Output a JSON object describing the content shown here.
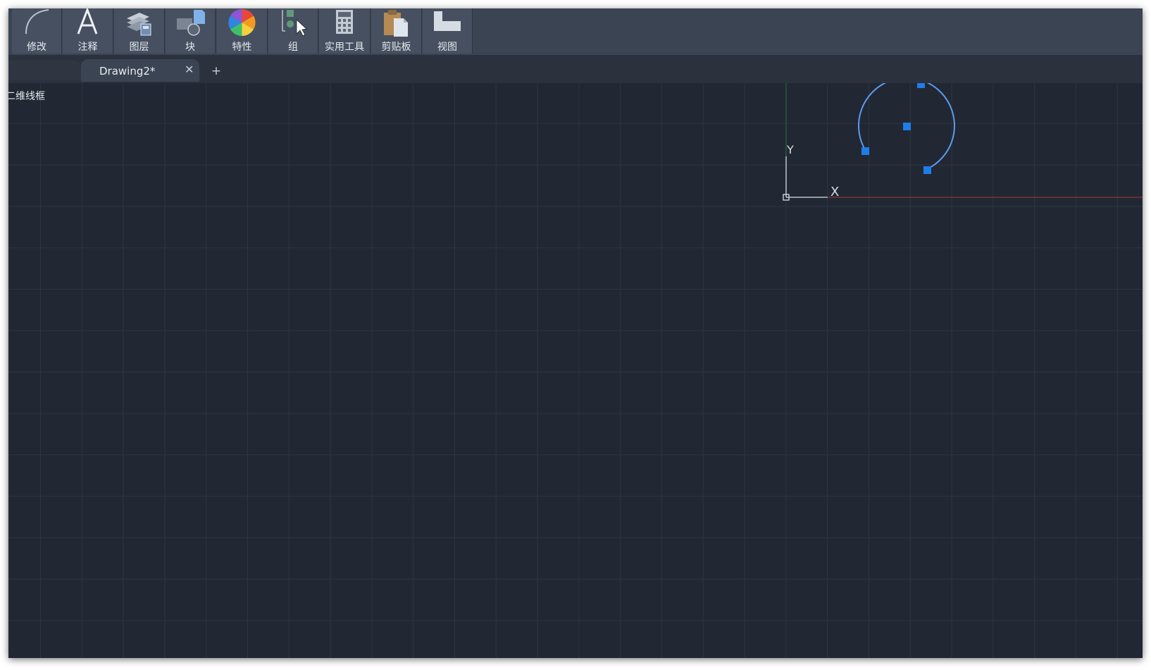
{
  "ribbon": {
    "groups": [
      {
        "id": "modify",
        "label": "修改",
        "icon": "arc-icon"
      },
      {
        "id": "annotation",
        "label": "注释",
        "icon": "text-a-icon"
      },
      {
        "id": "layers",
        "label": "图层",
        "icon": "layers-icon"
      },
      {
        "id": "block",
        "label": "块",
        "icon": "block-icon"
      },
      {
        "id": "properties",
        "label": "特性",
        "icon": "color-wheel-icon"
      },
      {
        "id": "group",
        "label": "组",
        "icon": "group-select-icon"
      },
      {
        "id": "utilities",
        "label": "实用工具",
        "icon": "calculator-icon"
      },
      {
        "id": "clipboard",
        "label": "剪贴板",
        "icon": "clipboard-icon"
      },
      {
        "id": "view",
        "label": "视图",
        "icon": "view-icon"
      }
    ]
  },
  "tabs": {
    "active_title": "Drawing2*",
    "close_glyph": "✕",
    "add_glyph": "+"
  },
  "viewport": {
    "label": "二维线框"
  },
  "ucs": {
    "y_label": "Y",
    "x_label": "X"
  },
  "colors": {
    "background": "#212833",
    "ribbon": "#3b4453",
    "selection": "#1f7de8",
    "arc": "#5b9cf0",
    "x_axis": "#a33a3a",
    "y_axis": "#2e6b3e"
  }
}
